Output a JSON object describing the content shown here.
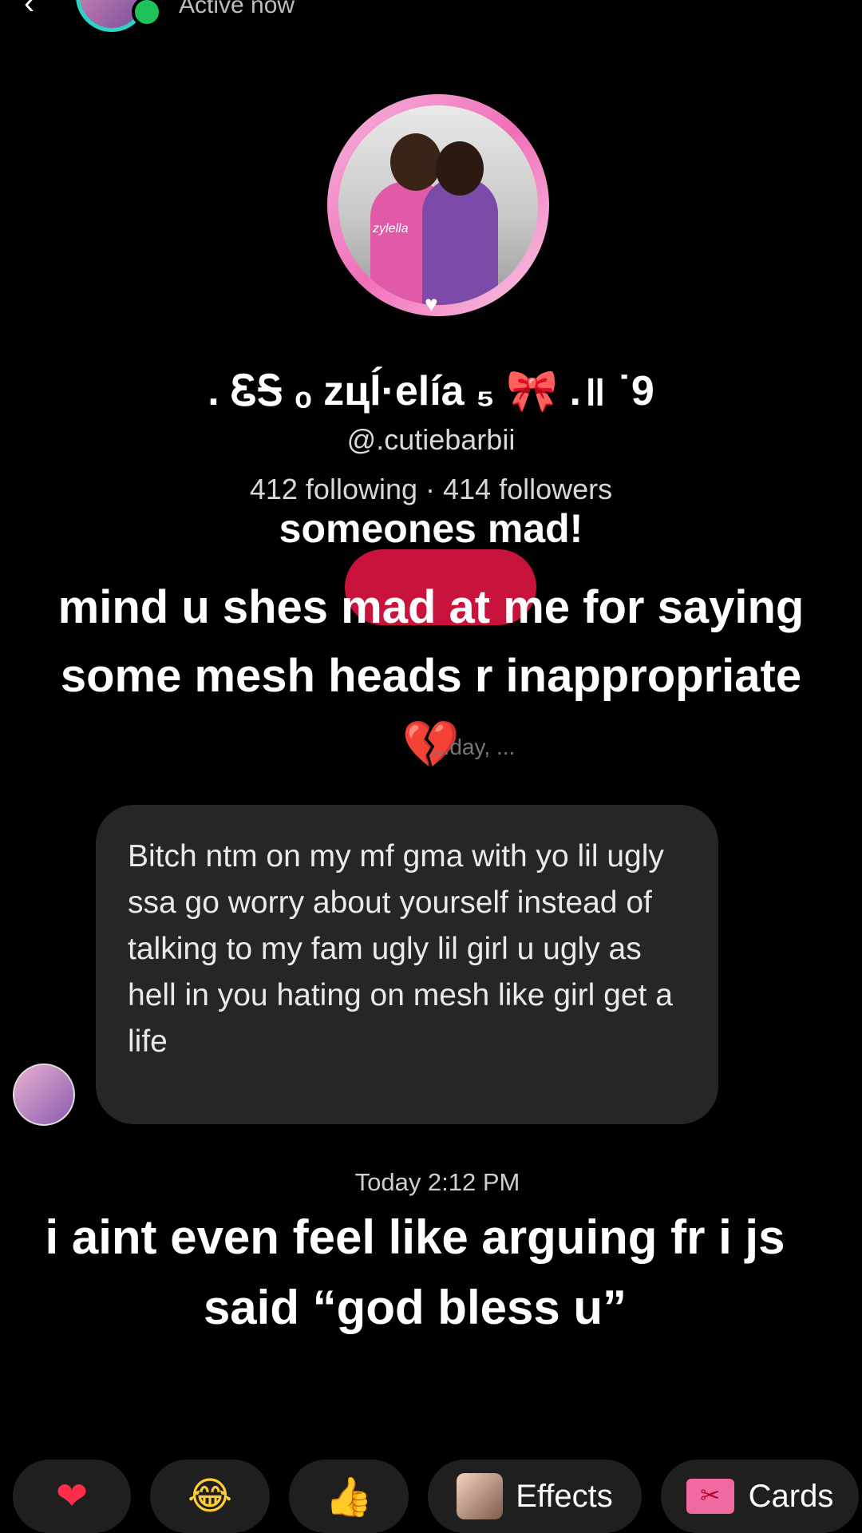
{
  "header": {
    "back_glyph": "‹",
    "status": "Active now"
  },
  "profile": {
    "photo_signature": "zylella",
    "display_name": ". ᏋᎦ ₒ zцĺ·elía ₅ 🎀 .॥ ˙9",
    "username": "@.cutiebarbii",
    "stats": "412 following · 414 followers"
  },
  "captions": {
    "top": "someones mad!",
    "main": "mind u shes mad at me for saying some mesh heads r inappropriate 💔",
    "bottom": "i aint even feel like arguing fr i js said “god bless u”"
  },
  "faint_date": "...day, ...",
  "message": {
    "text": "Bitch ntm on my mf gma with yo lil ugly ssa go worry about yourself instead of talking to my fam ugly lil girl u ugly as hell in you hating on mesh like girl get a life",
    "timestamp": "Today 2:12 PM"
  },
  "actions": {
    "heart": "❤",
    "laugh": "😂",
    "thumbs": "👍",
    "effects_label": "Effects",
    "cards_label": "Cards",
    "cards_icon_glyph": "✂"
  },
  "colors": {
    "background": "#000000",
    "bubble": "#262626",
    "pill_red": "#c8143c",
    "online_green": "#1fc15a",
    "ring_pink": "#f06fb7"
  }
}
